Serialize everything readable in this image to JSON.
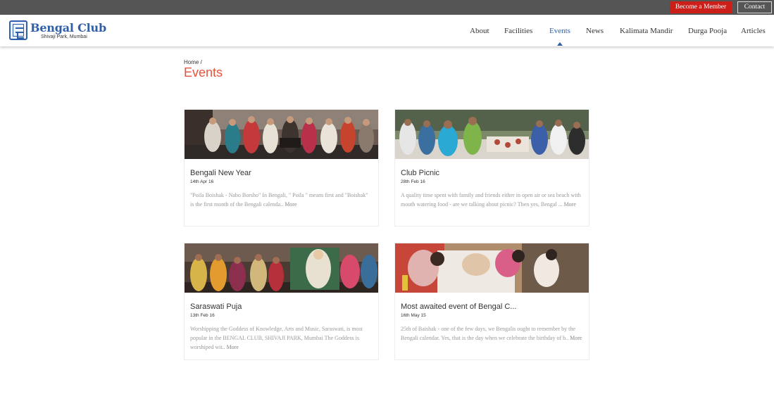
{
  "topbar": {
    "member_button": "Become a Member",
    "contact_button": "Contact",
    "member_color": "#cc1f1a"
  },
  "logo": {
    "title": "Bengal Club",
    "subtitle": "Shivaji Park, Mumbai"
  },
  "nav": {
    "items": [
      "About",
      "Facilities",
      "Events",
      "News",
      "Kalimata Mandir",
      "Durga Pooja",
      "Articles"
    ],
    "active": "Events"
  },
  "breadcrumb": {
    "home": "Home",
    "separator": "/"
  },
  "page": {
    "title": "Events"
  },
  "events": [
    {
      "title": "Bengali New Year",
      "date": "14th Apr 16",
      "excerpt": "\"Poila Boishak - Nabo Borsho\" In Bengali, \" Poila \" means first and \"Boishak\" is the first month of the Bengali calenda..",
      "more": "More"
    },
    {
      "title": "Club Picnic",
      "date": "28th Feb 16",
      "excerpt": "A quality time spent with family and friends either in open air or sea beach with mouth watering food - are we talking about picnic? Then yes, Bengal ...",
      "more": "More"
    },
    {
      "title": "Saraswati Puja",
      "date": "13th Feb 16",
      "excerpt": "Worshipping the Goddess of Knowledge, Arts and Music, Saraswati, is most popular in the BENGAL CLUB, SHIVAJI PARK, Mumbai The Goddess is worshiped wit..",
      "more": "More"
    },
    {
      "title": "Most awaited event of Bengal C...",
      "date": "16th May 15",
      "excerpt": "25th of Baishak - one of the few days, we Bengalis ought to remember by the Bengali calendar. Yes, that is the day when we celebrate the birthday of b..",
      "more": "More"
    }
  ],
  "colors": {
    "accent_blue": "#2e5fa8",
    "title_red": "#e5533d",
    "topbar_gray": "#555555"
  }
}
